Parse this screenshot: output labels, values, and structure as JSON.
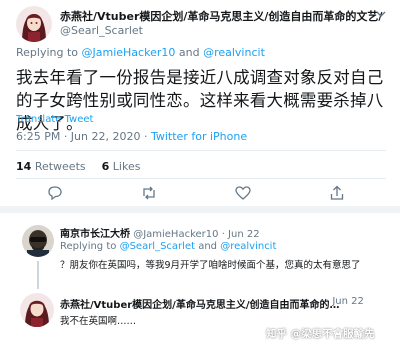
{
  "main_tweet": {
    "display_name": "赤燕社/Vtuber模因企划/革命马克思主义/创造自由而革命的文艺/",
    "handle": "@Searl_Scarlet",
    "replying_prefix": "Replying to ",
    "reply_to_1": "@JamieHacker10",
    "reply_and": " and ",
    "reply_to_2": "@realvincit",
    "text": "我去年看了一份报告是接近八成调查对象反对自己的子女跨性别或同性恋。这样来看大概需要杀掉八成人了。",
    "translate_label": "Translate Tweet",
    "time": "6:25 PM · Jun 22, 2020 · ",
    "source": "Twitter for iPhone",
    "retweets_count": "14",
    "retweets_label": "Retweets",
    "likes_count": "6",
    "likes_label": "Likes"
  },
  "reply_1": {
    "display_name": "南京市长江大桥",
    "handle": "@JamieHacker10",
    "time": "· Jun 22",
    "replying_prefix": "Replying to ",
    "reply_to_1": "@Searl_Scarlet",
    "reply_and": " and ",
    "reply_to_2": "@realvincit",
    "text": "？朋友你在英国吗，等我9月开学了咱啥时候面个基，您真的太有意思了"
  },
  "reply_2": {
    "display_name": "赤燕社/Vtuber模因企划/革命马克思主义/创造自由而革命的…",
    "time": "· Jun 22",
    "text": "我不在英国啊……"
  },
  "watermark": "知乎 @梁思不會服輸先",
  "icons": {
    "caret": "chevron-down-icon",
    "reply": "reply-icon",
    "retweet": "retweet-icon",
    "like": "heart-icon",
    "share": "share-icon"
  },
  "colors": {
    "link": "#1da1f2",
    "muted": "#657786",
    "text": "#14171a",
    "divider": "#e6ecf0"
  }
}
